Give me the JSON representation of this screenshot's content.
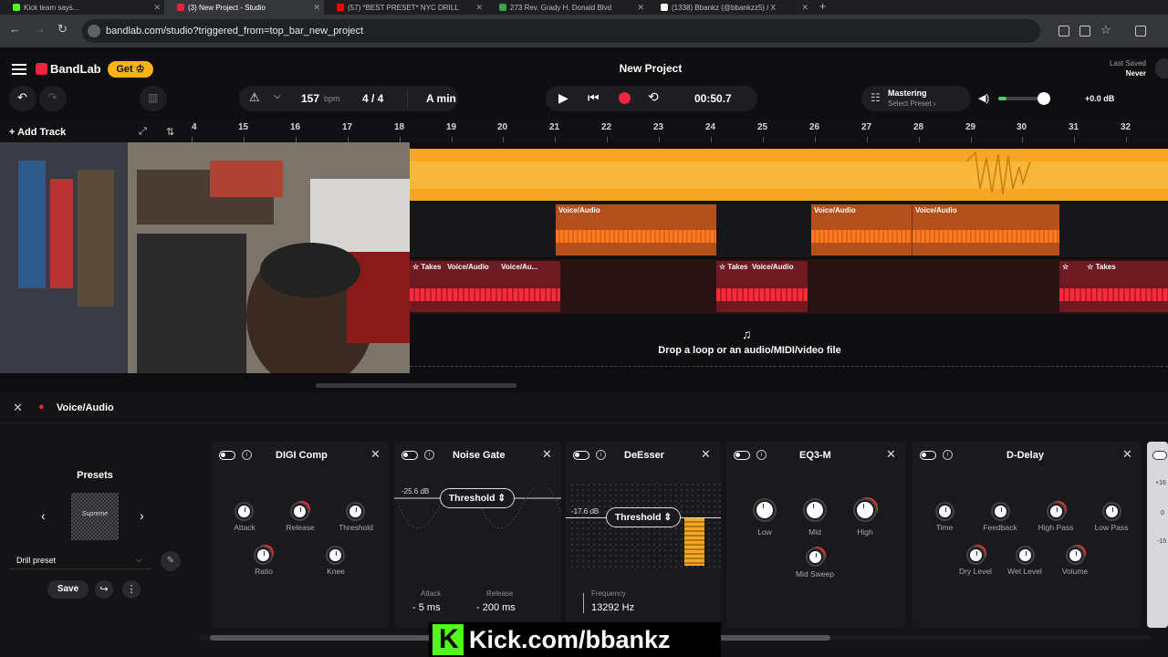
{
  "browser": {
    "tabs": [
      {
        "title": "Kick team says...",
        "color": "#53fc18"
      },
      {
        "title": "(3) New Project - Studio",
        "color": "#f0243b"
      },
      {
        "title": "(57) *BEST PRESET* NYC DRILL",
        "color": "#ff0000"
      },
      {
        "title": "273 Rev. Grady H. Donald Blvd",
        "color": "#34a853"
      },
      {
        "title": "(1338) Bbankz (@bbankzz5) / X",
        "color": "#ffffff"
      }
    ],
    "new_tab": "+",
    "url": "bandlab.com/studio?triggered_from=top_bar_new_project"
  },
  "app": {
    "brand": "BandLab",
    "get_label": "Get",
    "project_title": "New Project",
    "last_saved_label": "Last Saved",
    "last_saved_value": "Never"
  },
  "transport": {
    "bpm": "157",
    "bpm_unit": "bpm",
    "time_sig": "4 / 4",
    "key": "A min",
    "time": "00:50.7",
    "mastering_label": "Mastering",
    "mastering_sub": "Select Preset ›",
    "volume_db": "+0.0 dB",
    "volume_level": 0.55
  },
  "timeline": {
    "add_track": "Add Track",
    "ruler": [
      "4",
      "15",
      "16",
      "17",
      "18",
      "19",
      "20",
      "21",
      "22",
      "23",
      "24",
      "25",
      "26",
      "27",
      "28",
      "29",
      "30",
      "31",
      "32"
    ],
    "voice_label": "Voice/Audio",
    "takes_label": "Takes",
    "voice_short": "Voice/Au...",
    "drop_text": "Drop a loop or an audio/MIDI/video file"
  },
  "panel": {
    "track_name": "Voice/Audio",
    "presets_title": "Presets",
    "preset_thumb": "Supreme",
    "preset_selected": "Drill preset",
    "save_label": "Save",
    "effects": {
      "digi": {
        "title": "DIGI Comp",
        "knobs": [
          "Attack",
          "Release",
          "Threshold",
          "Ratio",
          "Knee"
        ]
      },
      "gate": {
        "title": "Noise Gate",
        "db": "-25.6 dB",
        "threshold": "Threshold",
        "attack_label": "Attack",
        "attack_value": "5 ms",
        "release_label": "Release",
        "release_value": "200 ms"
      },
      "desser": {
        "title": "DeEsser",
        "db": "-17.6 dB",
        "threshold": "Threshold",
        "freq_label": "Frequency",
        "freq_value": "13292 Hz"
      },
      "eq": {
        "title": "EQ3-M",
        "knobs": [
          "Low",
          "Mid",
          "High",
          "Mid Sweep"
        ]
      },
      "delay": {
        "title": "D-Delay",
        "knobs": [
          "Time",
          "Feedback",
          "High Pass",
          "Low Pass",
          "Dry Level",
          "Wet Level",
          "Volume"
        ]
      }
    },
    "side_ticks": [
      "+16",
      "0",
      "-15"
    ]
  },
  "overlay": {
    "kick_text": "Kick.com/bbankz"
  }
}
